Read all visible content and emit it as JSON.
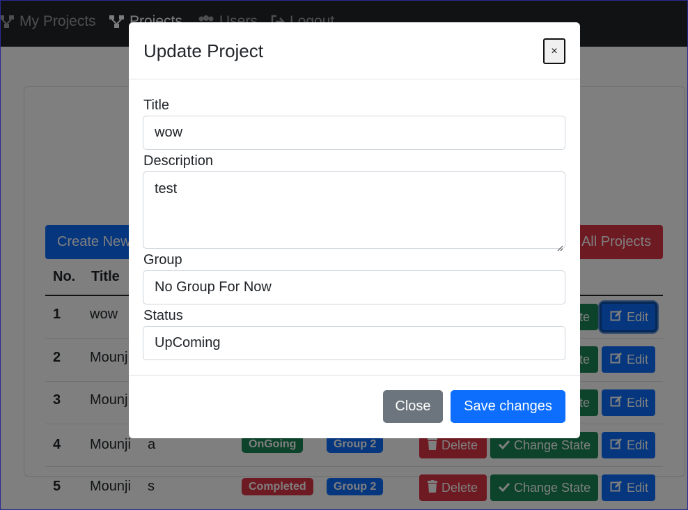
{
  "navbar": {
    "items": [
      {
        "label": "My Projects",
        "icon": "diagram-icon"
      },
      {
        "label": "Projects",
        "icon": "diagram-icon"
      },
      {
        "label": "Users",
        "icon": "users-icon"
      },
      {
        "label": "Logout",
        "icon": "sign-out-icon"
      }
    ]
  },
  "toolbar": {
    "create_label": "Create New",
    "delete_all_label": "All Projects"
  },
  "table": {
    "headers": {
      "no": "No.",
      "title": "Title"
    },
    "rows": [
      {
        "no": "1",
        "title": "wow",
        "description": "",
        "status": "",
        "group": ""
      },
      {
        "no": "2",
        "title": "Mounj",
        "description": "",
        "status": "",
        "group": ""
      },
      {
        "no": "3",
        "title": "Mounj",
        "description": "",
        "status": "",
        "group": ""
      },
      {
        "no": "4",
        "title": "Mounji",
        "description": "a",
        "status": "OnGoing",
        "group": "Group 2"
      },
      {
        "no": "5",
        "title": "Mounji",
        "description": "s",
        "status": "Completed",
        "group": "Group 2"
      }
    ],
    "actions": {
      "delete_label": "Delete",
      "change_state_label": "Change State",
      "change_state_partial": "te",
      "edit_label": "Edit"
    }
  },
  "modal": {
    "title": "Update Project",
    "close_x": "×",
    "fields": {
      "title": {
        "label": "Title",
        "value": "wow"
      },
      "description": {
        "label": "Description",
        "value": "test"
      },
      "group": {
        "label": "Group",
        "value": "No Group For Now"
      },
      "status": {
        "label": "Status",
        "value": "UpComing"
      }
    },
    "close_button": "Close",
    "save_button": "Save changes"
  },
  "colors": {
    "primary": "#0d6efd",
    "danger": "#dc3545",
    "success": "#198754",
    "secondary": "#6c757d",
    "navbar": "#212529"
  }
}
